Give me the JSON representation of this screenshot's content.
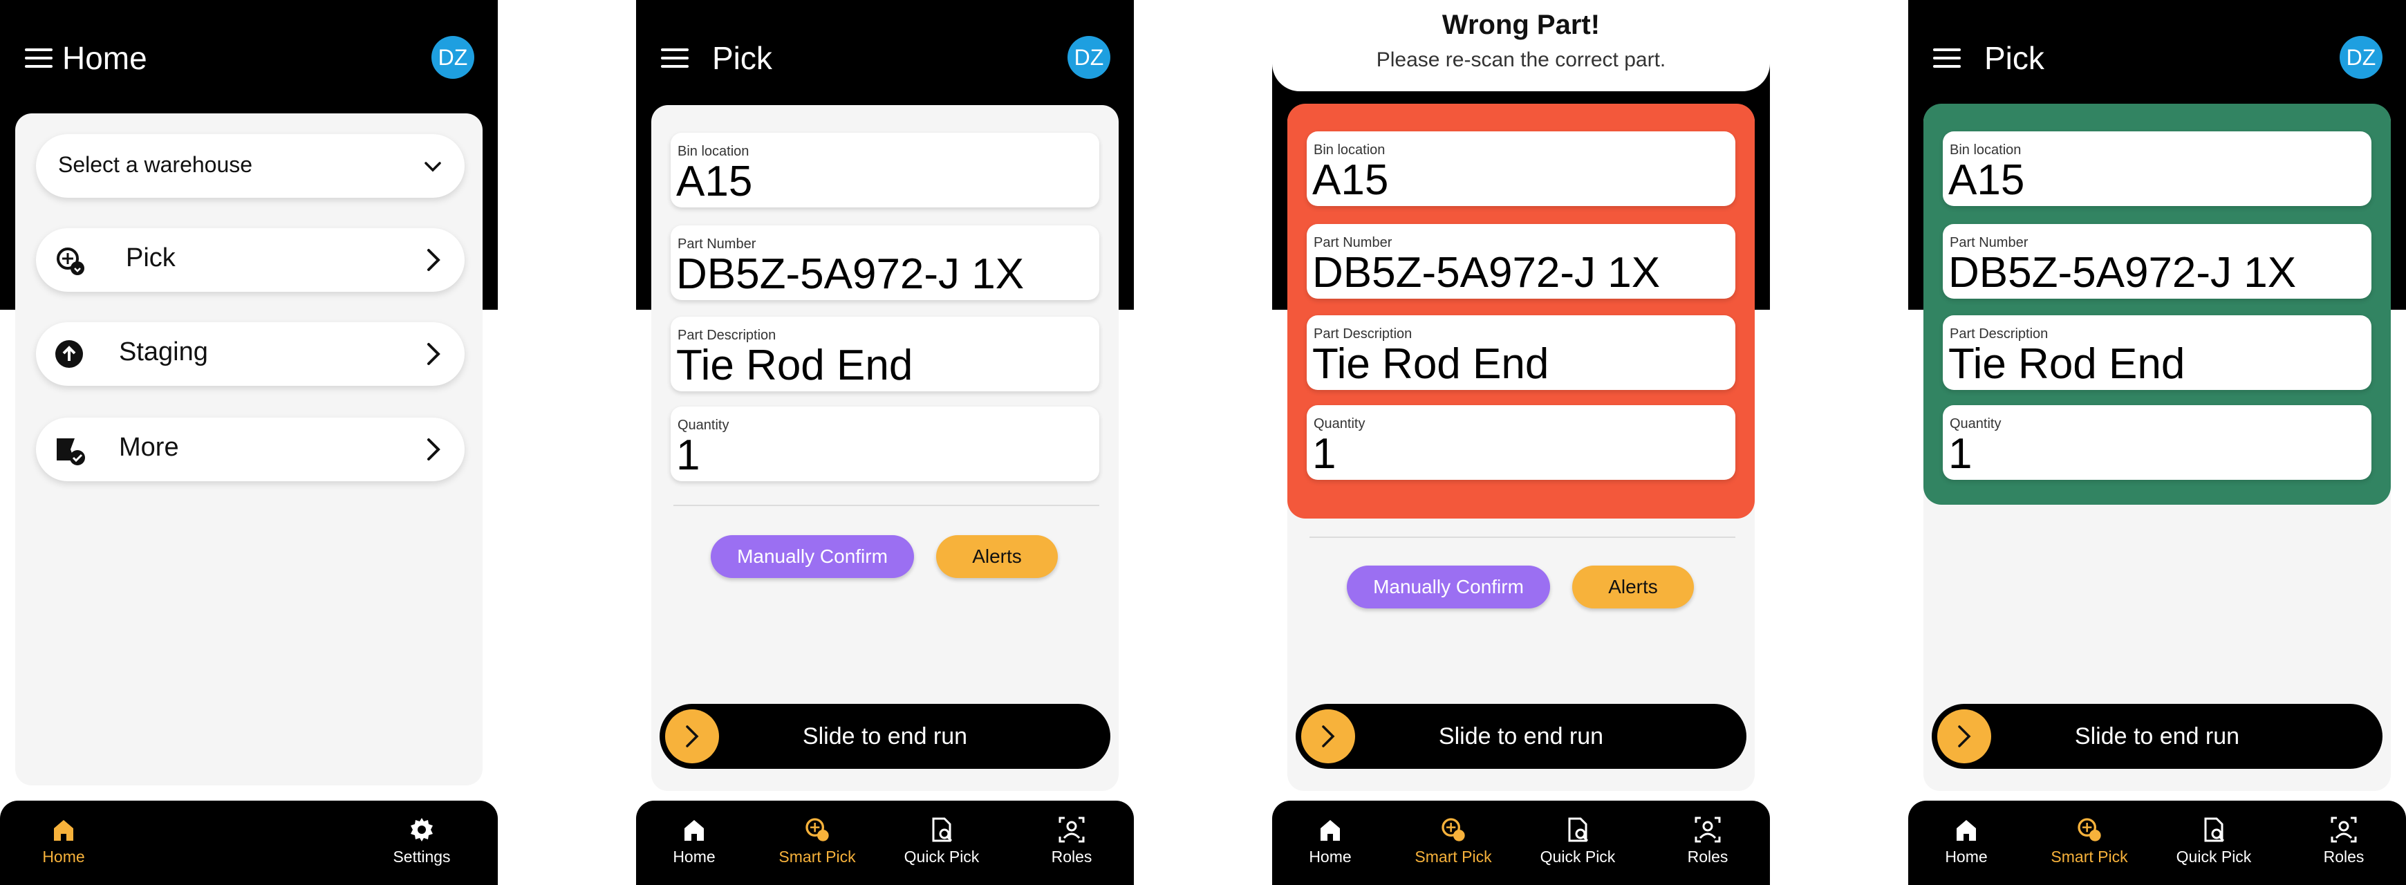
{
  "colors": {
    "accent": "#f7b23b",
    "confirm": "#9b6ff2",
    "wrong": "#f3583b",
    "ok": "#328462",
    "avatar": "#1e9fe0"
  },
  "screen1": {
    "title": "Home",
    "avatar": "DZ",
    "warehouse_select": "Select a warehouse",
    "menu": [
      {
        "label": "Pick",
        "icon": "smart-pick-icon"
      },
      {
        "label": "Staging",
        "icon": "upload-icon"
      },
      {
        "label": "More",
        "icon": "more-icon"
      }
    ],
    "nav": [
      {
        "label": "Home",
        "icon": "home-icon",
        "active": true
      },
      {
        "label": "Settings",
        "icon": "gear-icon",
        "active": false
      }
    ]
  },
  "pick_screen": {
    "title": "Pick",
    "avatar": "DZ",
    "fields": [
      {
        "label": "Bin location",
        "value": "A15"
      },
      {
        "label": "Part Number",
        "value": "DB5Z-5A972-J 1X"
      },
      {
        "label": "Part Description",
        "value": "Tie Rod End"
      },
      {
        "label": "Quantity",
        "value": "1"
      }
    ],
    "confirm_label": "Manually Confirm",
    "alerts_label": "Alerts",
    "slider_label": "Slide to end run",
    "nav": [
      {
        "label": "Home",
        "icon": "home-icon",
        "active": false
      },
      {
        "label": "Smart Pick",
        "icon": "smart-pick-icon",
        "active": true
      },
      {
        "label": "Quick Pick",
        "icon": "quick-pick-icon",
        "active": false
      },
      {
        "label": "Roles",
        "icon": "roles-icon",
        "active": false
      }
    ]
  },
  "wrong_banner": {
    "title": "Wrong Part!",
    "message": "Please re-scan the correct part."
  }
}
